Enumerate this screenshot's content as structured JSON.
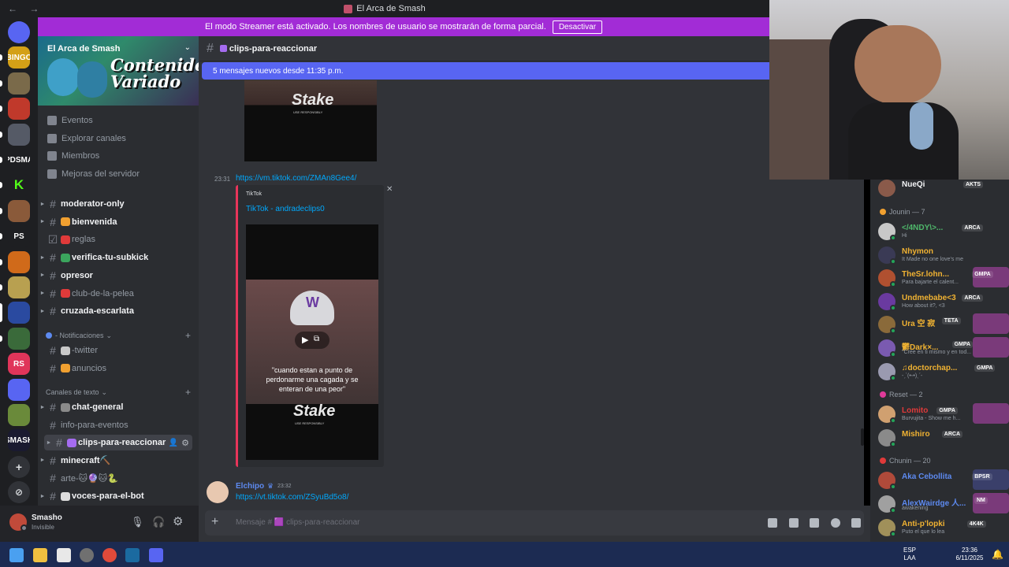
{
  "window": {
    "title": "El Arca de Smash",
    "nav_arrows": "← →"
  },
  "streamer_banner": {
    "text": "El modo Streamer está activado. Los nombres de usuario se mostrarán de forma parcial.",
    "button": "Desactivar"
  },
  "server_list": {
    "items": [
      {
        "label": "",
        "color": "#5865f2",
        "icon": "discord-home-icon"
      },
      {
        "label": "BINGO",
        "color": "#d4a017"
      },
      {
        "label": "",
        "color": "#7a6a4a"
      },
      {
        "label": "",
        "color": "#c0392b"
      },
      {
        "label": "",
        "color": "#555a66"
      },
      {
        "label": "PDSMA",
        "color": "#1e1f22"
      },
      {
        "label": "K",
        "color": "#1e1f22",
        "text_color": "#53fc18"
      },
      {
        "label": "",
        "color": "#8a5a3a"
      },
      {
        "label": "PS",
        "color": "#1e1f22"
      },
      {
        "label": "",
        "color": "#d06a1a"
      },
      {
        "label": "",
        "color": "#b8a050"
      },
      {
        "label": "",
        "color": "#2a4aa0"
      },
      {
        "label": "",
        "color": "#3a6a3a"
      },
      {
        "label": "RS",
        "color": "#e0355a"
      },
      {
        "label": "",
        "color": "#5865f2"
      },
      {
        "label": "",
        "color": "#6a8a3a"
      },
      {
        "label": "SMASH",
        "color": "#1a1a30"
      }
    ],
    "add_label": "+",
    "discover_label": "⊘"
  },
  "server": {
    "name": "El Arca de Smash",
    "banner_text": "Contenido Variado"
  },
  "server_nav": [
    "Eventos",
    "Explorar canales",
    "Miembros",
    "Mejoras del servidor"
  ],
  "channels_top": [
    {
      "name": "moderator-only",
      "bold": true,
      "arrow": true
    },
    {
      "name": "bienvenida",
      "bold": true,
      "arrow": true,
      "emoji_color": "#f0a030"
    },
    {
      "name": "reglas",
      "bold": false,
      "arrow": false,
      "emoji_color": "#e03a3a",
      "rules": true
    },
    {
      "name": "verifica-tu-subkick",
      "bold": true,
      "arrow": true,
      "emoji_color": "#3ba55d"
    },
    {
      "name": "opresor",
      "bold": true,
      "arrow": true
    },
    {
      "name": "club-de-la-pelea",
      "bold": false,
      "arrow": true,
      "emoji_color": "#e03a3a"
    },
    {
      "name": "cruzada-escarlata",
      "bold": true,
      "arrow": true
    }
  ],
  "category_notif": "- Notificaciones",
  "channels_notif": [
    {
      "name": "-twitter",
      "emoji_color": "#c8c8c8"
    },
    {
      "name": "anuncios",
      "emoji_color": "#f0a030"
    }
  ],
  "category_text": "Canales de texto",
  "channels_text": [
    {
      "name": "chat-general",
      "bold": true,
      "arrow": true,
      "emoji_color": "#8a8a8a"
    },
    {
      "name": "info-para-eventos",
      "bold": false,
      "arrow": false
    },
    {
      "name": "clips-para-reaccionar",
      "bold": true,
      "arrow": true,
      "selected": true,
      "emoji_color": "#a56cf0"
    },
    {
      "name": "minecraft⛏️",
      "bold": true,
      "arrow": true
    },
    {
      "name": "arte-🐱🔮🐱🐍",
      "bold": false,
      "arrow": false
    },
    {
      "name": "voces-para-el-bot",
      "bold": true,
      "arrow": true,
      "emoji_color": "#dddddd"
    }
  ],
  "user": {
    "name": "Smasho",
    "status": "Invisible"
  },
  "chat": {
    "channel": "clips-para-reaccionar",
    "new_messages": "5 mensajes nuevos desde 11:35 p.m.",
    "msg1": {
      "time": "23:31",
      "link": "https://vm.tiktok.com/ZMAn8Gee4/"
    },
    "embed": {
      "provider": "TikTok",
      "title": "TikTok - andradeclips0",
      "caption": "\"cuando estan a punto de perdonarme una cagada y se enteran de una peor\"",
      "brand": "Stake",
      "brand_sub": "USE RESPONSIBLY"
    },
    "msg2": {
      "author": "Elchipo",
      "time": "23:32",
      "link": "https://vt.tiktok.com/ZSyuBd5o8/"
    },
    "composer_placeholder": "Mensaje # 🟪 clips-para-reaccionar"
  },
  "members": {
    "top_partial": {
      "name": "NueQi",
      "tag": "AKTS"
    },
    "groups": [
      {
        "title": "Jounin — 7",
        "icon_color": "#f0a030",
        "items": [
          {
            "name": "</4NDY\\>...",
            "color": "#4fb86b",
            "tag": "ARCA",
            "sub": "Hi",
            "avatar": "#c8c8c8"
          },
          {
            "name": "Nhymon",
            "color": "#f0b232",
            "tag": "",
            "sub": "It Made no one love's me",
            "avatar": "#3a3a55"
          },
          {
            "name": "TheSr.lohn...",
            "color": "#f0b232",
            "tag": "GMPA",
            "sub": "Para bajarte el calent...",
            "avatar": "#b05030",
            "highlight": "#7a3a7a"
          },
          {
            "name": "Undmebabe<3",
            "color": "#f0b232",
            "tag": "ARCA",
            "sub": "How about it?, <3",
            "avatar": "#6a3aa0"
          },
          {
            "name": "Ura 空 寂",
            "color": "#f0b232",
            "tag": "TETA",
            "sub": "",
            "avatar": "#8a6a3a",
            "highlight": "#7a3a7a"
          },
          {
            "name": "鬱Dark×...",
            "color": "#f0b232",
            "tag": "GMPA",
            "sub": "\"Cree en ti mismo y en tod...",
            "avatar": "#7a5ab0",
            "highlight": "#7a3a7a"
          },
          {
            "name": "♫doctorchap...",
            "color": "#f0b232",
            "tag": "GMPA",
            "sub": "-ˏˋ(•ᵕ•)ˎˊ-",
            "avatar": "#9a9ab0"
          }
        ]
      },
      {
        "title": "Reset — 2",
        "icon_color": "#e03a9a",
        "items": [
          {
            "name": "Lomito",
            "color": "#e03a3a",
            "tag": "GMPA",
            "sub": "Burvujita - Show me h...",
            "avatar": "#d0a070",
            "highlight": "#7a3a7a"
          },
          {
            "name": "Mishiro",
            "color": "#f0b232",
            "tag": "ARCA",
            "sub": "",
            "avatar": "#8a8a8a"
          }
        ]
      },
      {
        "title": "Chunin — 20",
        "icon_color": "#e03a3a",
        "items": [
          {
            "name": "Aka Cebollita",
            "color": "#5d8af0",
            "tag": "BPSR",
            "sub": "",
            "avatar": "#b04a3a",
            "highlight": "#3a3f6a"
          },
          {
            "name": "AlexWairdge 人...",
            "color": "#5d8af0",
            "tag": "NM",
            "sub": "awakening",
            "avatar": "#a0a0a0",
            "highlight": "#7a3a7a"
          },
          {
            "name": "Anti-p'lopki",
            "color": "#f0b232",
            "tag": "4K4K",
            "sub": "Puto el que lo lea",
            "avatar": "#a0905a"
          }
        ]
      }
    ]
  },
  "taskbar": {
    "lang1": "ESP",
    "lang2": "LAA",
    "time": "23:36",
    "date": "6/11/2025"
  }
}
